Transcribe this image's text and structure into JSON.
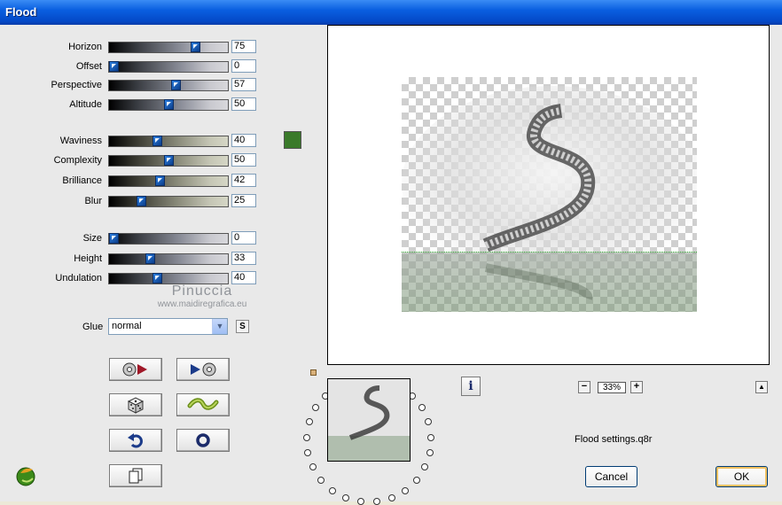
{
  "window": {
    "title": "Flood"
  },
  "sliders": [
    {
      "id": "horizon",
      "label": "Horizon",
      "value": "75",
      "level": 0.75,
      "style": "gray"
    },
    {
      "id": "offset",
      "label": "Offset",
      "value": "0",
      "level": 0.0,
      "style": "gray"
    },
    {
      "id": "perspective",
      "label": "Perspective",
      "value": "57",
      "level": 0.57,
      "style": "gray"
    },
    {
      "id": "altitude",
      "label": "Altitude",
      "value": "50",
      "level": 0.5,
      "style": "gray"
    },
    {
      "id": "waviness",
      "label": "Waviness",
      "value": "40",
      "level": 0.4,
      "style": "tan"
    },
    {
      "id": "complexity",
      "label": "Complexity",
      "value": "50",
      "level": 0.5,
      "style": "tan"
    },
    {
      "id": "brilliance",
      "label": "Brilliance",
      "value": "42",
      "level": 0.42,
      "style": "tan"
    },
    {
      "id": "blur",
      "label": "Blur",
      "value": "25",
      "level": 0.25,
      "style": "tan"
    },
    {
      "id": "size",
      "label": "Size",
      "value": "0",
      "level": 0.0,
      "style": "gray"
    },
    {
      "id": "height",
      "label": "Height",
      "value": "33",
      "level": 0.33,
      "style": "gray"
    },
    {
      "id": "undulation",
      "label": "Undulation",
      "value": "40",
      "level": 0.4,
      "style": "gray"
    }
  ],
  "flood_color": "#3a7a2a",
  "watermark": {
    "name": "Pinuccia",
    "site": "www.maidiregrafica.eu"
  },
  "glue": {
    "label": "Glue",
    "value": "normal",
    "s_label": "S"
  },
  "tool_buttons": [
    {
      "id": "load-preset",
      "icon": "disc-arrow-right-icon"
    },
    {
      "id": "save-preset",
      "icon": "arrow-disc-right-icon"
    },
    {
      "id": "randomize",
      "icon": "dice-icon"
    },
    {
      "id": "wave",
      "icon": "wave-icon"
    },
    {
      "id": "undo",
      "icon": "undo-arrow-icon"
    },
    {
      "id": "reset",
      "icon": "ring-icon"
    },
    {
      "id": "copy",
      "icon": "copy-pages-icon"
    }
  ],
  "zoom": {
    "value": "33%",
    "minus": "−",
    "plus": "+"
  },
  "info_label": "i",
  "up_label": "▲",
  "settings_file": "Flood settings.q8r",
  "buttons": {
    "cancel": "Cancel",
    "ok": "OK"
  }
}
